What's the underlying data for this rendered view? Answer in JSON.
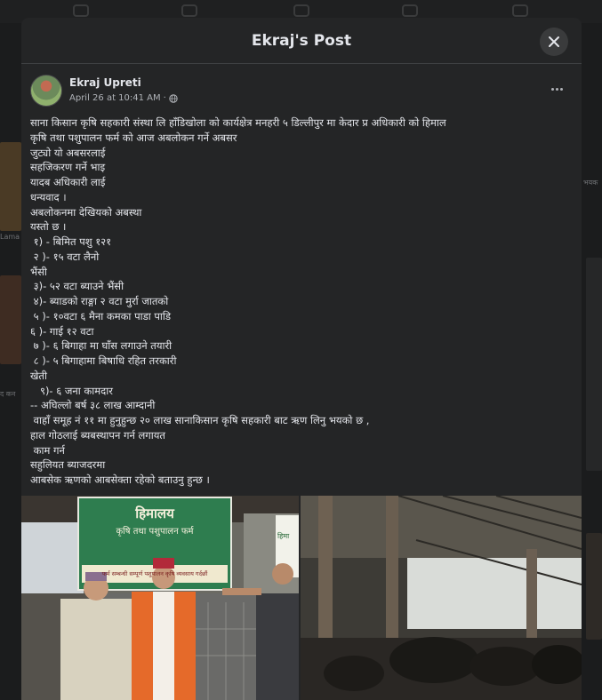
{
  "modal": {
    "title": "Ekraj's Post"
  },
  "post": {
    "author": "Ekraj Upreti",
    "date": "April 26 at 10:41 AM",
    "separator": "·",
    "privacy_icon": "globe-icon",
    "body_lines": [
      "साना किसान कृषि सहकारी संस्था लि हाँडिखोला को कार्यक्षेत्र मनहरी ५ डिल्लीपुर मा केदार प्र अधिकारी को हिमाल",
      "कृषि तथा पशुपालन फर्म को आज अबलोकन गर्ने अबसर",
      "जुट्यो यो अबसरलाई",
      "सहजिकरण गर्ने भाइ",
      "यादब अधिकारी लाई",
      "धन्यवाद ।",
      "अबलोकनमा देखियको अबस्था",
      "यस्तो छ ।",
      " १) - बिमित पशु १२१",
      " २ )- १५ वटा लैनो",
      "भैंसी",
      " ३)- ५२ वटा ब्याउने भैंसी",
      " ४)- ब्याडको राङ्गा २ वटा मुर्रा जातको",
      " ५ )- १०वटा ६ मैना कमका पाडा पाडि",
      "६ )- गाई १२ वटा",
      " ७ )- ६ बिगाहा मा घाँस लगाउने तयारी",
      " ८ )- ५ बिगाहामा बिषाधि रहित तरकारी",
      "खेती",
      "   ९)- ६ जना कामदार",
      "-- अघिल्लो बर्ष ३८ लाख आम्दानी",
      " वाहाँ समूह नं ११ मा हुनुहुन्छ २० लाख सानाकिसान कृषि सहकारी बाट ऋण लिनु भयको छ ,",
      "हाल गोठलाई ब्यबस्थापन गर्न लगायत",
      " काम गर्न",
      "सहुलियत ब्याजदरमा",
      "आबसेक ऋणको आबसेक्ता रहेको बताउनु हुन्छ ।"
    ]
  },
  "photos": [
    {
      "kind": "farm-visit-photo",
      "sign_line_1": "हिमालय",
      "sign_line_2": "कृषि तथा पशुपालन फर्म",
      "sign_line_3": "फर्म सम्बन्धी सम्पूर्ण पशुपालन कृषि व्यवसाय गर्दछौं",
      "side_sign": "हिमा"
    },
    {
      "kind": "cattle-shed-photo"
    }
  ],
  "background": {
    "left_label_1": "Lama",
    "left_label_2": "द कन",
    "right_label": "भयक"
  },
  "colors": {
    "page_bg": "#18191a",
    "modal_bg": "#242526",
    "text": "#e4e6eb",
    "secondary_text": "#b0b3b8",
    "close_btn_bg": "#3a3b3c",
    "sign_green": "#2e7d4f"
  }
}
